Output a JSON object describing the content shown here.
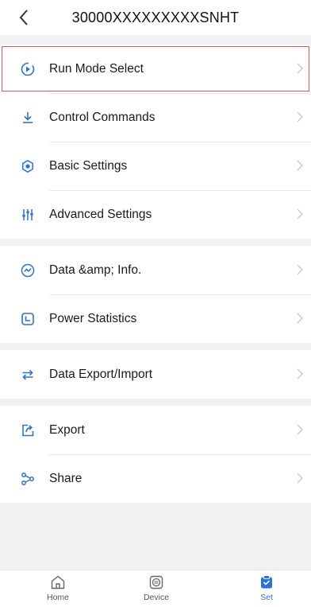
{
  "header": {
    "title": "30000XXXXXXXXXSNHT"
  },
  "groups": [
    {
      "items": [
        {
          "label": "Run Mode Select",
          "icon": "run-mode-icon",
          "selected": true
        },
        {
          "label": "Control Commands",
          "icon": "download-icon"
        },
        {
          "label": "Basic Settings",
          "icon": "basic-settings-icon"
        },
        {
          "label": "Advanced Settings",
          "icon": "sliders-icon"
        }
      ]
    },
    {
      "items": [
        {
          "label": "Data &amp; Info.",
          "icon": "data-info-icon"
        },
        {
          "label": "Power Statistics",
          "icon": "power-statistics-icon"
        }
      ]
    },
    {
      "items": [
        {
          "label": "Data Export/Import",
          "icon": "swap-icon"
        }
      ]
    },
    {
      "items": [
        {
          "label": "Export",
          "icon": "export-icon"
        },
        {
          "label": "Share",
          "icon": "share-icon"
        }
      ]
    }
  ],
  "tabbar": {
    "tabs": [
      {
        "label": "Home",
        "icon": "home-icon"
      },
      {
        "label": "Device",
        "icon": "device-icon"
      },
      {
        "label": "Set",
        "icon": "set-icon",
        "active": true
      }
    ]
  },
  "colors": {
    "accent": "#2a73d9",
    "selection": "#e05a5a",
    "background": "#f2f2f4"
  }
}
